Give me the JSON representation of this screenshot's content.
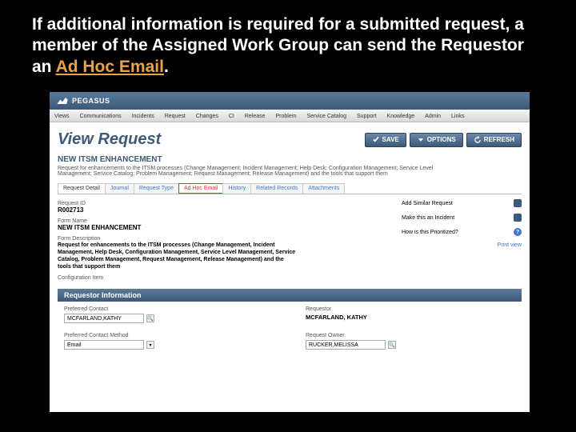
{
  "caption": {
    "pre": "If additional information is required for a submitted request, a member of the Assigned Work Group can send the Requestor an ",
    "highlight": "Ad Hoc Email",
    "post": "."
  },
  "brand": "PEGASUS",
  "nav": [
    "Views",
    "Communications",
    "Incidents",
    "Request",
    "Changes",
    "CI",
    "Release",
    "Problem",
    "Service Catalog",
    "Support",
    "Knowledge",
    "Admin",
    "Links"
  ],
  "page_title": "View Request",
  "buttons": {
    "save": "SAVE",
    "options": "OPTIONS",
    "refresh": "REFRESH"
  },
  "sub_title": "NEW ITSM ENHANCEMENT",
  "sub_desc": "Request for enhancements to the ITSM processes (Change Management; Incident Management; Help Desk; Configuration Management; Service Level Management; Service Catalog; Problem Management; Request Management; Release Management) and the tools that support them",
  "tabs": [
    "Request Detail",
    "Journal",
    "Request Type",
    "Ad Hoc Email",
    "History",
    "Related Records",
    "Attachments"
  ],
  "fields": {
    "request_id_label": "Request ID",
    "request_id": "R002713",
    "form_name_label": "Form Name",
    "form_name": "NEW ITSM ENHANCEMENT",
    "form_desc_label": "Form Description",
    "form_desc": "Request for enhancements to the ITSM processes (Change Management, Incident Management, Help Desk, Configuration Management, Service Level Management, Service Catalog, Problem Management, Request Management, Release Management) and the tools that support them",
    "config_item_label": "Configuration Item"
  },
  "side": {
    "similar": "Add Similar Request",
    "incident": "Make this an Incident",
    "prioritized": "How is this Prioritized?",
    "print": "Print view"
  },
  "section_header": "Requestor Information",
  "req": {
    "pref_contact_label": "Preferred Contact",
    "pref_contact_value": "MCFARLAND,KATHY",
    "requestor_label": "Requestor",
    "requestor_value": "MCFARLAND, KATHY",
    "pref_method_label": "Preferred Contact Method",
    "pref_method_value": "Email",
    "owner_label": "Request Owner",
    "owner_value": "RUCKER,MELISSA"
  }
}
